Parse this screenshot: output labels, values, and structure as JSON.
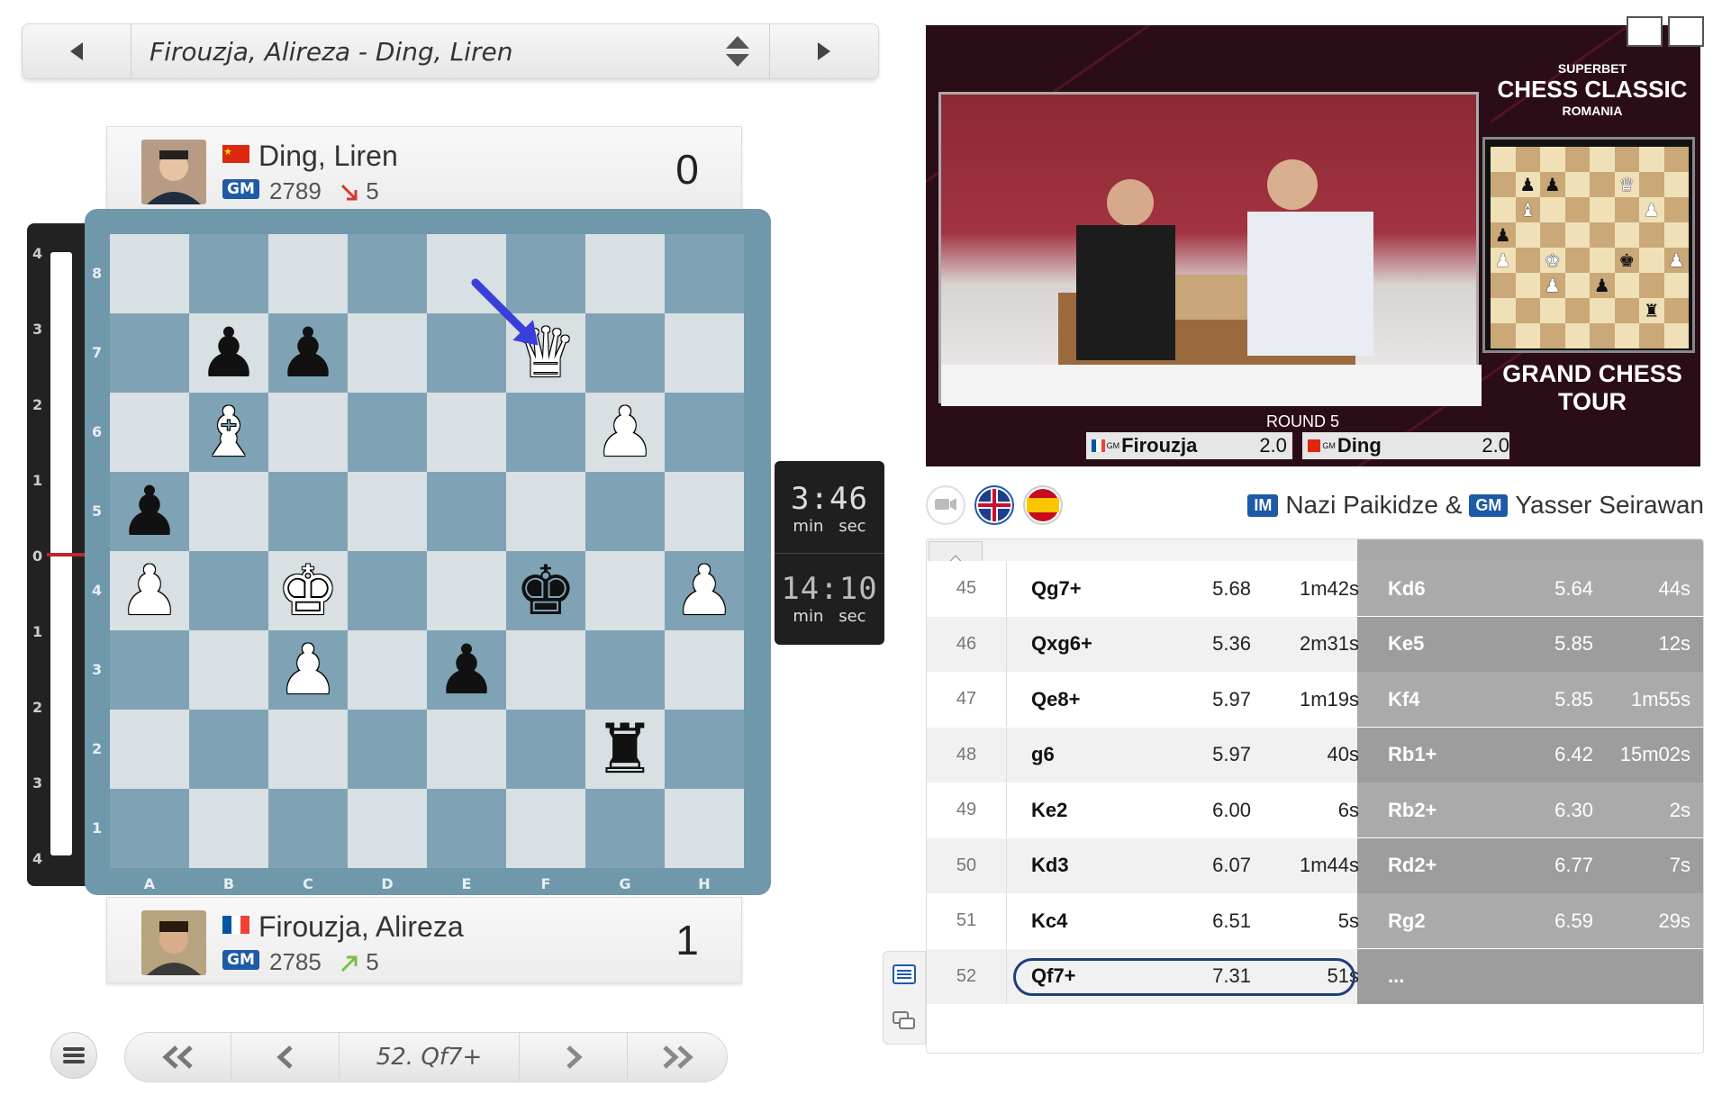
{
  "game_selector": {
    "title": "Firouzja, Alireza - Ding, Liren",
    "prev_icon": "triangle-left-icon",
    "next_icon": "triangle-right-icon",
    "updown_icon": "updown-arrows-icon"
  },
  "top_player": {
    "name": "Ding, Liren",
    "flag": "china-flag-icon",
    "title": "GM",
    "rating": "2789",
    "change": "5",
    "change_dir": "down",
    "score": "0"
  },
  "bottom_player": {
    "name": "Firouzja, Alireza",
    "flag": "france-flag-icon",
    "title": "GM",
    "rating": "2785",
    "change": "5",
    "change_dir": "up",
    "score": "1"
  },
  "eval_bar": {
    "labels": [
      "4",
      "3",
      "2",
      "1",
      "0",
      "1",
      "2",
      "3",
      "4"
    ],
    "value": 0
  },
  "board": {
    "files": [
      "A",
      "B",
      "C",
      "D",
      "E",
      "F",
      "G",
      "H"
    ],
    "ranks": [
      "8",
      "7",
      "6",
      "5",
      "4",
      "3",
      "2",
      "1"
    ],
    "pieces": [
      {
        "sq": "f7",
        "glyph": "♛",
        "color": "w"
      },
      {
        "sq": "b7",
        "glyph": "♟",
        "color": "b"
      },
      {
        "sq": "c7",
        "glyph": "♟",
        "color": "b"
      },
      {
        "sq": "b6",
        "glyph": "♝",
        "color": "w"
      },
      {
        "sq": "g6",
        "glyph": "♟",
        "color": "w"
      },
      {
        "sq": "a5",
        "glyph": "♟",
        "color": "b"
      },
      {
        "sq": "a4",
        "glyph": "♟",
        "color": "w"
      },
      {
        "sq": "c4",
        "glyph": "♚",
        "color": "w"
      },
      {
        "sq": "f4",
        "glyph": "♚",
        "color": "b"
      },
      {
        "sq": "h4",
        "glyph": "♟",
        "color": "w"
      },
      {
        "sq": "c3",
        "glyph": "♟",
        "color": "w"
      },
      {
        "sq": "e3",
        "glyph": "♟",
        "color": "b"
      },
      {
        "sq": "g2",
        "glyph": "♜",
        "color": "b"
      }
    ],
    "last_move": {
      "from": "e8",
      "to": "f7"
    }
  },
  "clocks": {
    "top": {
      "time": "3:46",
      "min": "min",
      "sec": "sec"
    },
    "bottom": {
      "time": "14:10",
      "min": "min",
      "sec": "sec"
    }
  },
  "nav": {
    "menu_icon": "hamburger-icon",
    "first_icon": "double-chevron-left-icon",
    "prev_icon": "chevron-left-icon",
    "current_move": "52. Qf7+",
    "next_icon": "chevron-right-icon",
    "last_icon": "double-chevron-right-icon"
  },
  "video": {
    "event_top": "SUPERBET",
    "event_name": "CHESS CLASSIC",
    "event_sub": "ROMANIA",
    "tour": "GRAND CHESS TOUR",
    "round": "ROUND 5",
    "player_left": "Firouzja",
    "score_left": "2.0",
    "player_right": "Ding",
    "score_right": "2.0",
    "left_title": "GM",
    "right_title": "GM"
  },
  "commentary": {
    "camera_icon": "camera-icon",
    "uk_flag_icon": "uk-flag-icon",
    "spain_flag_icon": "spain-flag-icon",
    "commentator1_title": "IM",
    "commentator1": "Nazi Paikidze &",
    "commentator2_title": "GM",
    "commentator2": "Yasser Seirawan"
  },
  "moves": [
    {
      "num": "45",
      "w": "Qg7+",
      "we": "5.68",
      "wt": "1m42s",
      "b": "Kd6",
      "be": "5.64",
      "bt": "44s"
    },
    {
      "num": "46",
      "w": "Qxg6+",
      "we": "5.36",
      "wt": "2m31s",
      "b": "Ke5",
      "be": "5.85",
      "bt": "12s"
    },
    {
      "num": "47",
      "w": "Qe8+",
      "we": "5.97",
      "wt": "1m19s",
      "b": "Kf4",
      "be": "5.85",
      "bt": "1m55s"
    },
    {
      "num": "48",
      "w": "g6",
      "we": "5.97",
      "wt": "40s",
      "b": "Rb1+",
      "be": "6.42",
      "bt": "15m02s"
    },
    {
      "num": "49",
      "w": "Ke2",
      "we": "6.00",
      "wt": "6s",
      "b": "Rb2+",
      "be": "6.30",
      "bt": "2s"
    },
    {
      "num": "50",
      "w": "Kd3",
      "we": "6.07",
      "wt": "1m44s",
      "b": "Rd2+",
      "be": "6.77",
      "bt": "7s"
    },
    {
      "num": "51",
      "w": "Kc4",
      "we": "6.51",
      "wt": "5s",
      "b": "Rg2",
      "be": "6.59",
      "bt": "29s"
    },
    {
      "num": "52",
      "w": "Qf7+",
      "we": "7.31",
      "wt": "51s",
      "b": "...",
      "be": "",
      "bt": ""
    }
  ],
  "colors": {
    "accent": "#1d5aa8",
    "board_light": "#d9e0e3",
    "board_dark": "#7fa3b5",
    "black_move_bg": "#9a9a9a",
    "arrow": "#3a3fd8"
  }
}
